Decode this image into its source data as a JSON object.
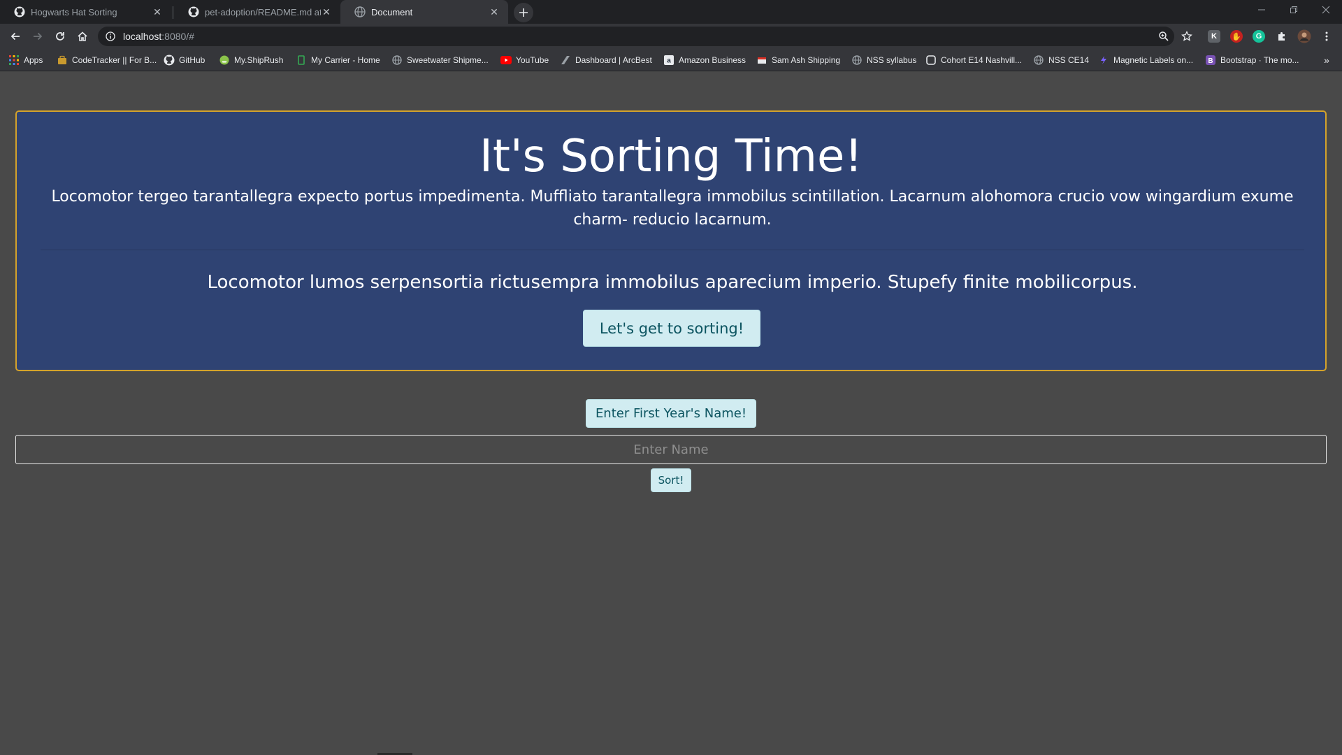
{
  "browser": {
    "tabs": [
      {
        "title": "Hogwarts Hat Sorting",
        "icon": "github-icon",
        "active": false
      },
      {
        "title": "pet-adoption/README.md at ma",
        "icon": "github-icon",
        "active": false
      },
      {
        "title": "Document",
        "icon": "globe-icon",
        "active": true
      }
    ],
    "address": {
      "host": "localhost",
      "path": ":8080/#"
    },
    "bookmarks": [
      {
        "label": "Apps",
        "icon": "apps-grid-icon"
      },
      {
        "label": "CodeTracker || For B...",
        "icon": "codetracker-icon"
      },
      {
        "label": "GitHub",
        "icon": "github-icon"
      },
      {
        "label": "My.ShipRush",
        "icon": "shiprush-icon"
      },
      {
        "label": "My Carrier - Home",
        "icon": "carrier-icon"
      },
      {
        "label": "Sweetwater Shipme...",
        "icon": "globe-icon"
      },
      {
        "label": "YouTube",
        "icon": "youtube-icon"
      },
      {
        "label": "Dashboard | ArcBest",
        "icon": "arcbest-icon"
      },
      {
        "label": "Amazon Business",
        "icon": "amazon-icon"
      },
      {
        "label": "Sam Ash Shipping",
        "icon": "samash-icon"
      },
      {
        "label": "NSS syllabus",
        "icon": "globe-icon"
      },
      {
        "label": "Cohort E14 Nashvill...",
        "icon": "cohort-icon"
      },
      {
        "label": "NSS CE14",
        "icon": "globe-icon"
      },
      {
        "label": "Magnetic Labels on...",
        "icon": "magnetic-icon"
      },
      {
        "label": "Bootstrap · The mo...",
        "icon": "bootstrap-icon"
      }
    ],
    "more_bookmarks": "»"
  },
  "page": {
    "title": "It's Sorting Time!",
    "lead1": "Locomotor tergeo tarantallegra expecto portus impedimenta. Muffliato tarantallegra immobilus scintillation. Lacarnum alohomora crucio vow wingardium exume charm- reducio lacarnum.",
    "lead2": "Locomotor lumos serpensortia rictusempra immobilus aparecium imperio. Stupefy finite mobilicorpus.",
    "start_button": "Let's get to sorting!",
    "enter_button": "Enter First Year's Name!",
    "name_placeholder": "Enter Name",
    "sort_button": "Sort!"
  },
  "colors": {
    "page_bg": "#494949",
    "jumbotron_bg": "#2f4373",
    "jumbotron_border": "#d4a32b",
    "button_bg": "#d1ecf1",
    "button_text": "#0c5460"
  }
}
